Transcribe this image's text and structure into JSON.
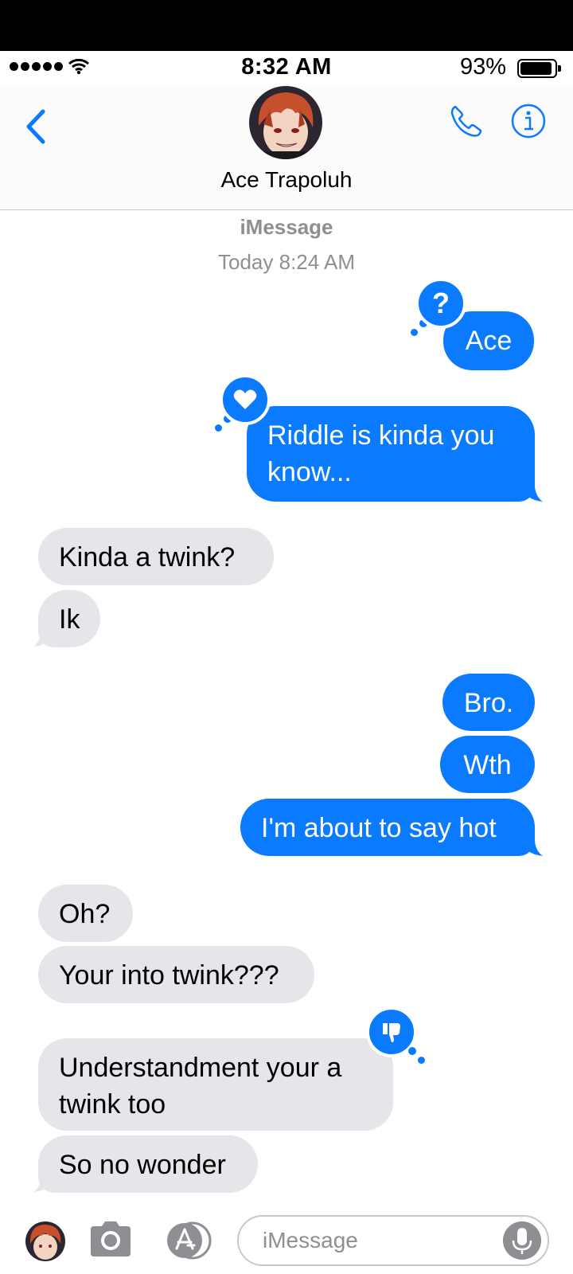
{
  "status_bar": {
    "time": "8:32 AM",
    "battery_percent": "93%",
    "battery_level": 0.93,
    "signal_bars": 5
  },
  "nav": {
    "contact_name": "Ace Trapoluh",
    "icons": [
      "back-chevron-icon",
      "phone-icon",
      "info-icon"
    ]
  },
  "thread_header": {
    "service": "iMessage",
    "timestamp": "Today 8:24 AM"
  },
  "messages": [
    {
      "from": "me",
      "text": "Ace",
      "tapback": "question"
    },
    {
      "from": "me",
      "text_lines": [
        "Riddle is kinda you",
        "know..."
      ],
      "tapback": "heart"
    },
    {
      "from": "them",
      "text": "Kinda a twink?"
    },
    {
      "from": "them",
      "text": "Ik"
    },
    {
      "from": "me",
      "text": "Bro."
    },
    {
      "from": "me",
      "text": "Wth"
    },
    {
      "from": "me",
      "text": "I'm about to say hot"
    },
    {
      "from": "them",
      "text": "Oh?"
    },
    {
      "from": "them",
      "text": "Your into twink???"
    },
    {
      "from": "them",
      "text_lines": [
        "Understandment your a",
        "twink too"
      ],
      "tapback": "thumbs-down"
    },
    {
      "from": "them",
      "text": "So no wonder"
    }
  ],
  "input": {
    "placeholder": "iMessage",
    "icons": [
      "avatar",
      "camera-icon",
      "app-store-icon",
      "microphone-icon"
    ]
  },
  "colors": {
    "accent": "#0a7aff",
    "incoming_bubble": "#e5e5ea",
    "secondary_text": "#8e8e93"
  }
}
